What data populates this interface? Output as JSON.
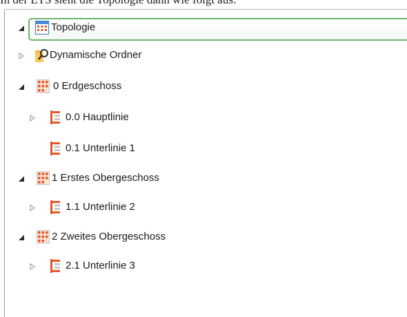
{
  "caption": {
    "text": "In der ETS sieht die Topologie dann wie folgt aus:"
  },
  "tree": {
    "items": [
      {
        "label": "Topologie",
        "state": "expanded",
        "icon": "topology-icon",
        "selected": true
      },
      {
        "label": "Dynamische Ordner",
        "state": "collapsed",
        "icon": "dynamic-folder-icon",
        "selected": false
      },
      {
        "label": "0 Erdgeschoss",
        "state": "expanded",
        "icon": "area-icon",
        "selected": false
      },
      {
        "label": "0.0 Hauptlinie",
        "state": "collapsed",
        "icon": "line-icon",
        "selected": false
      },
      {
        "label": "0.1 Unterlinie 1",
        "state": "leaf",
        "icon": "line-icon",
        "selected": false
      },
      {
        "label": "1 Erstes Obergeschoss",
        "state": "expanded",
        "icon": "area-icon",
        "selected": false
      },
      {
        "label": "1.1 Unterlinie 2",
        "state": "collapsed",
        "icon": "line-icon",
        "selected": false
      },
      {
        "label": "2 Zweites Obergeschoss",
        "state": "expanded",
        "icon": "area-icon",
        "selected": false
      },
      {
        "label": "2.1 Unterlinie 3",
        "state": "collapsed",
        "icon": "line-icon",
        "selected": false
      }
    ]
  },
  "colors": {
    "accent_orange": "#e2572a",
    "selection_border": "#6db36d",
    "folder_yellow": "#f2b233"
  }
}
